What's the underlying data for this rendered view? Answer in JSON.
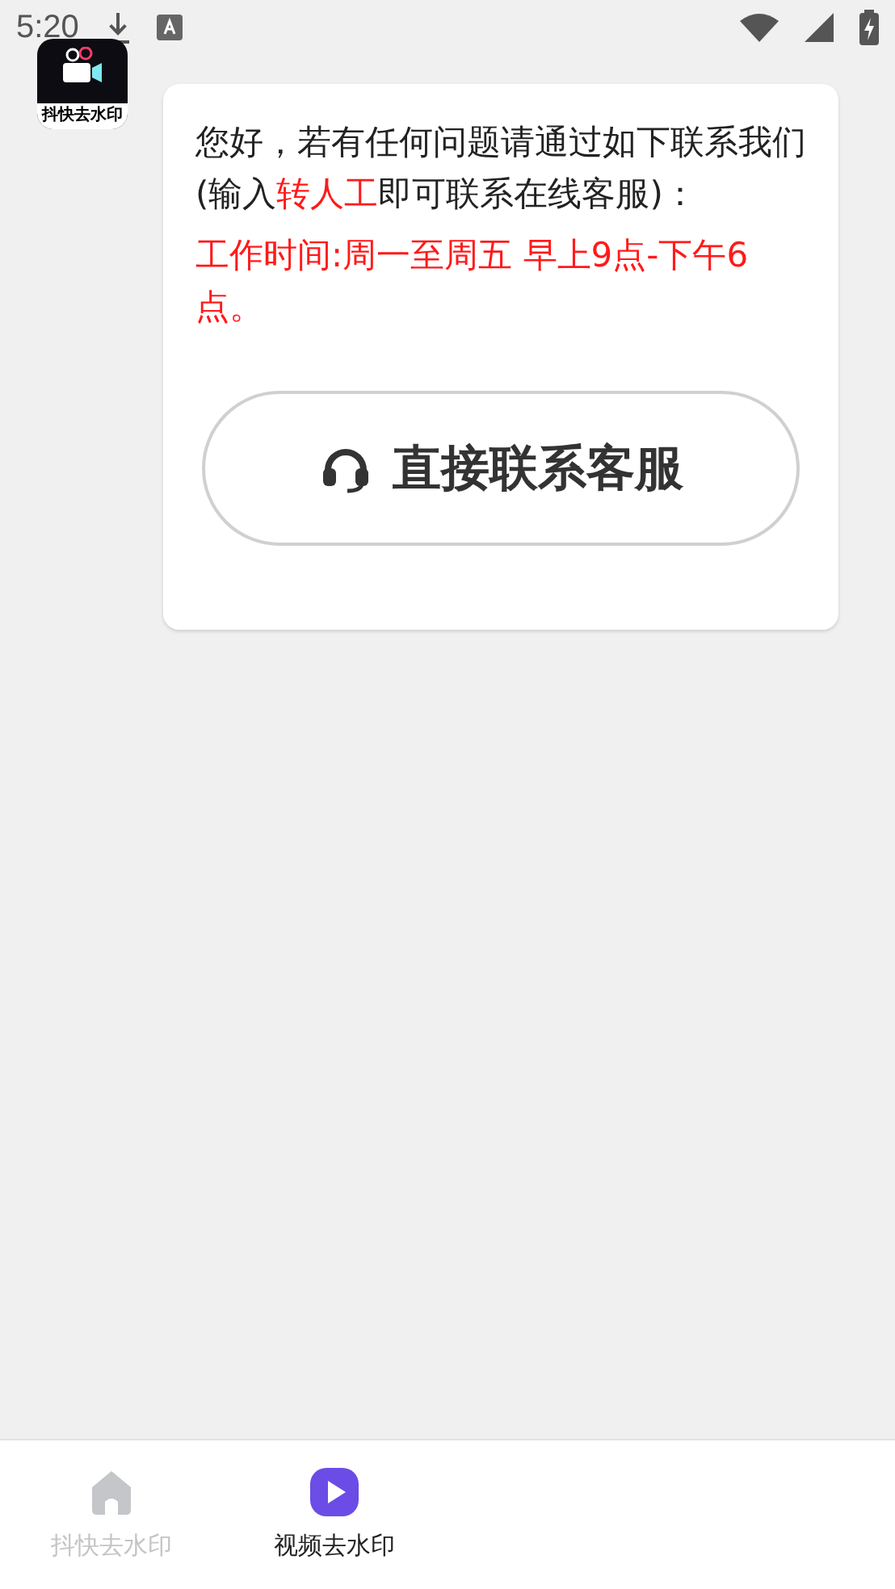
{
  "status_bar": {
    "time": "5:20"
  },
  "chat": {
    "avatar_text": "抖快去水印",
    "message": [
      {
        "text": "您好，若有任何问题请通过如下联系我们(输入",
        "highlight": false
      },
      {
        "text": "转人工",
        "highlight": true
      },
      {
        "text": "即可联系在线客服)：",
        "highlight": false
      }
    ],
    "hours": "工作时间:周一至周五 早上9点-下午6点。",
    "button": "直接联系客服"
  },
  "tabs": [
    {
      "label": "抖快去水印",
      "selected": false,
      "kind": "home"
    },
    {
      "label": "视频去水印",
      "selected": true,
      "kind": "play"
    }
  ]
}
